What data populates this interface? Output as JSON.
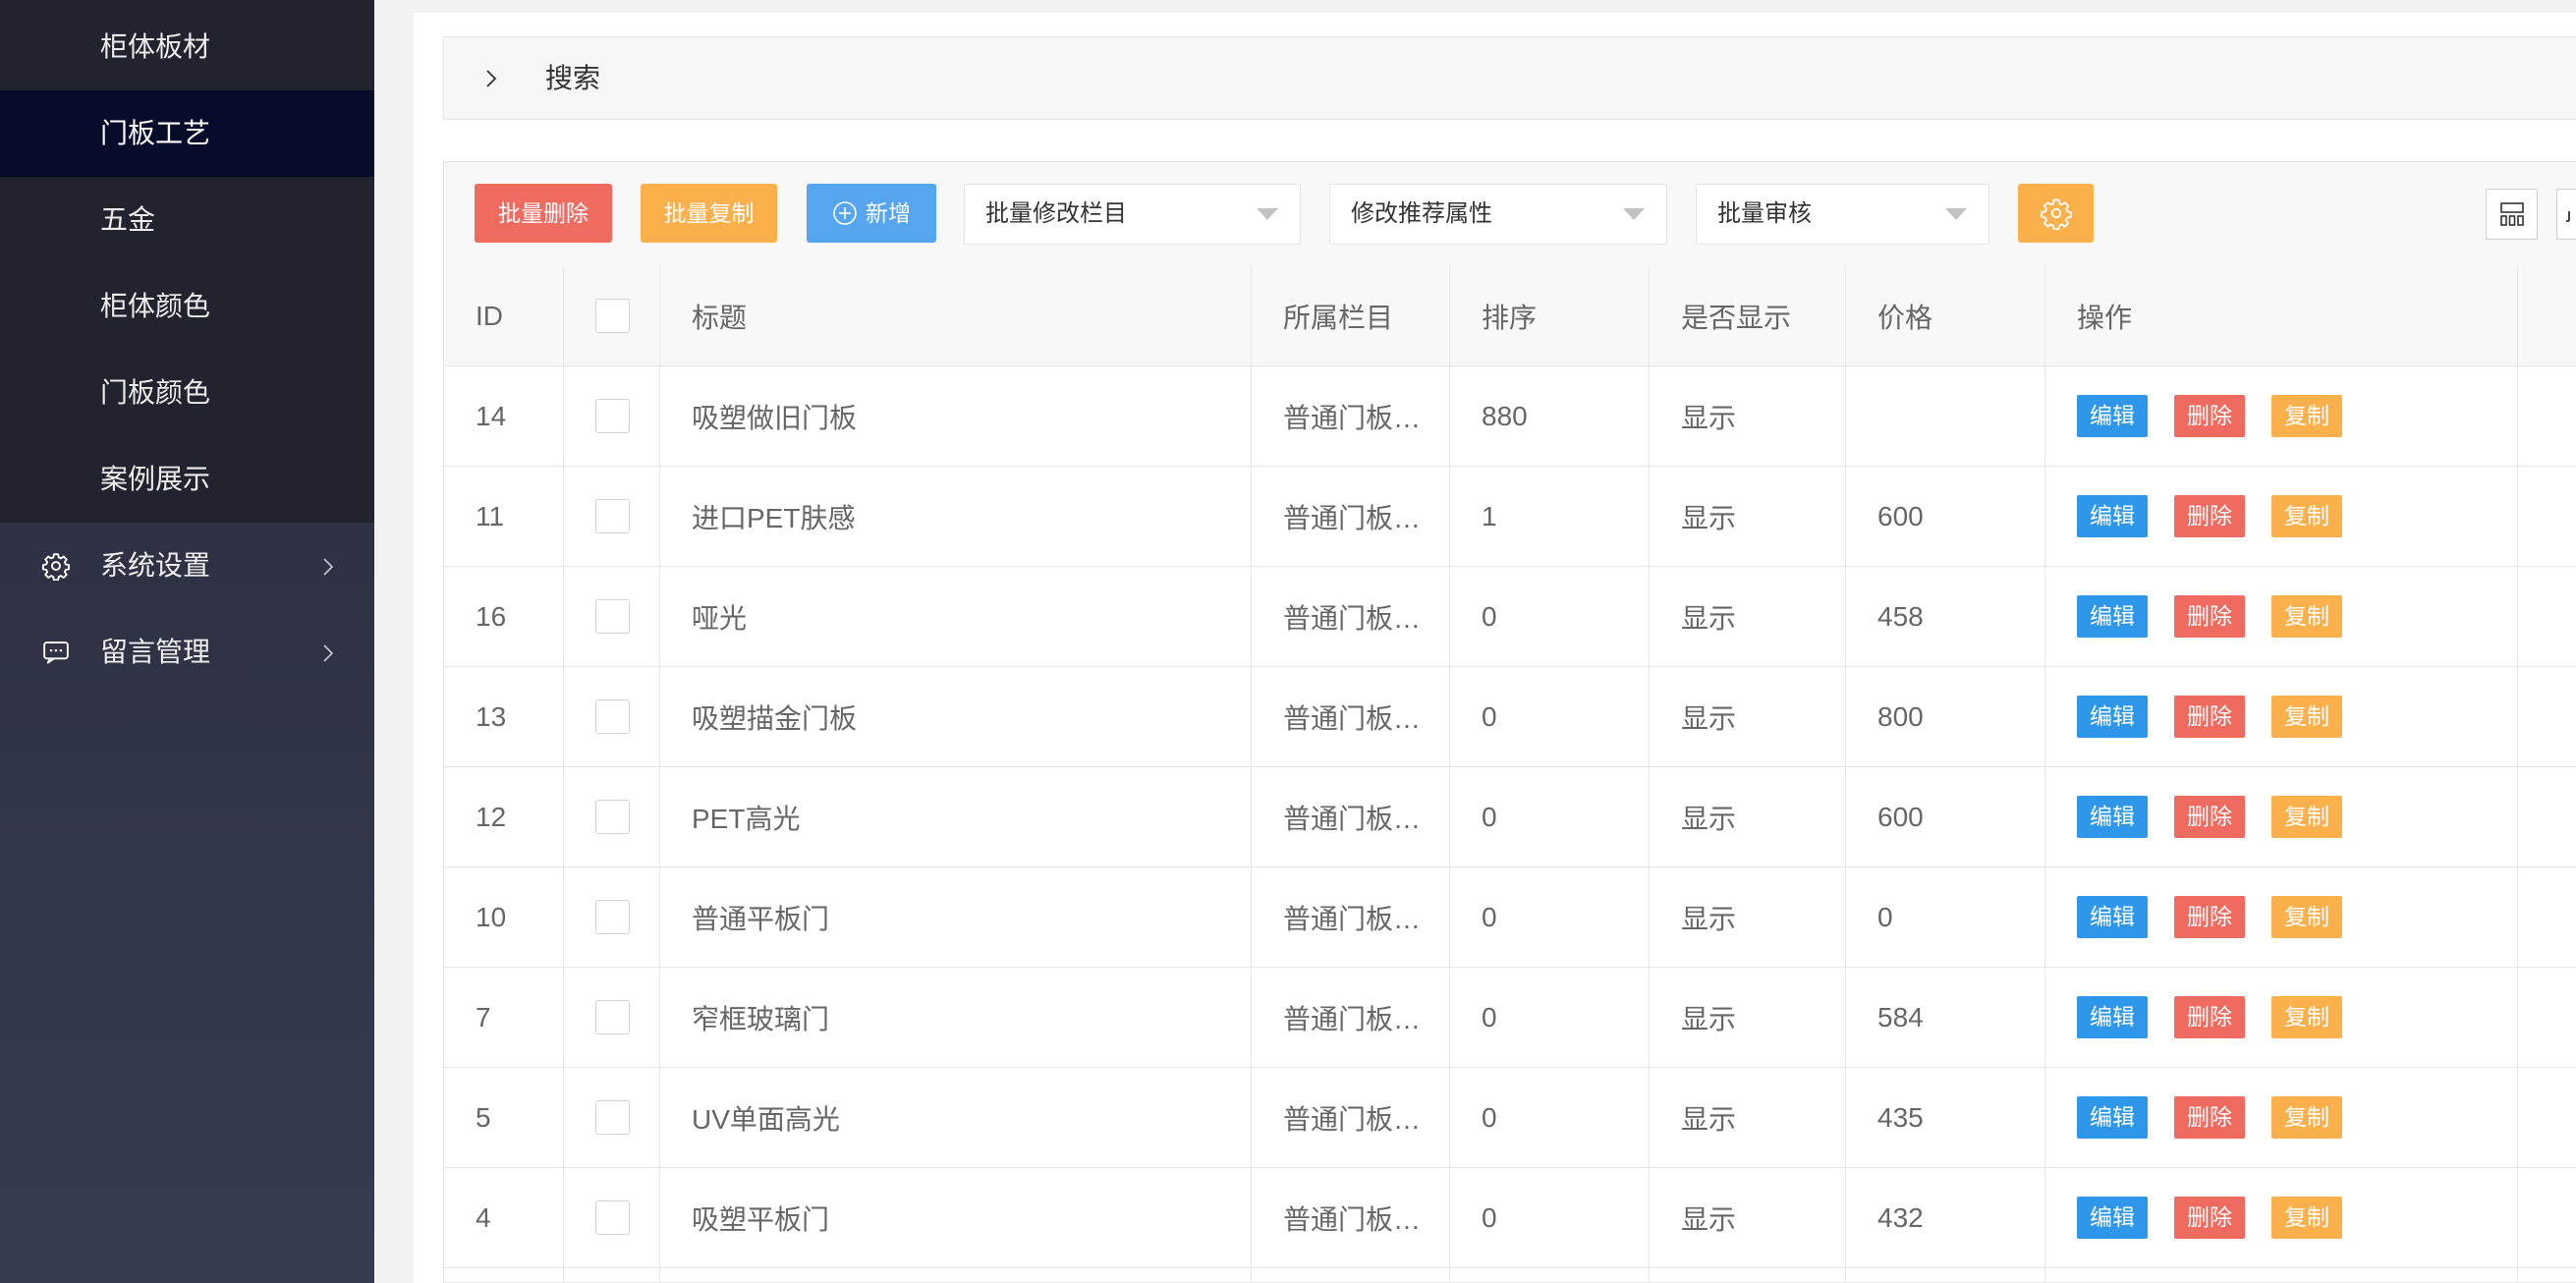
{
  "sidebar": {
    "submenu": [
      {
        "label": "柜体板材"
      },
      {
        "label": "门板工艺",
        "active": true
      },
      {
        "label": "五金"
      },
      {
        "label": "柜体颜色"
      },
      {
        "label": "门板颜色"
      },
      {
        "label": "案例展示"
      }
    ],
    "menu": [
      {
        "label": "系统设置",
        "icon": "gear-icon"
      },
      {
        "label": "留言管理",
        "icon": "message-icon"
      }
    ]
  },
  "search": {
    "label": "搜索",
    "icon": "chevron-right-icon"
  },
  "toolbar": {
    "batch_delete": "批量删除",
    "batch_copy": "批量复制",
    "add": "新增",
    "select_category": "批量修改栏目",
    "select_recommend": "修改推荐属性",
    "select_review": "批量审核",
    "settings_icon": "gear-icon",
    "layout_icon": "grid-icon",
    "export_icon": "export-icon"
  },
  "table": {
    "headers": {
      "id": "ID",
      "title": "标题",
      "category": "所属栏目",
      "sort": "排序",
      "visible": "是否显示",
      "price": "价格",
      "actions": "操作"
    },
    "rows": [
      {
        "id": "14",
        "title": "吸塑做旧门板",
        "category": "普通门板…",
        "sort": "880",
        "visible": "显示",
        "price": ""
      },
      {
        "id": "11",
        "title": "进口PET肤感",
        "category": "普通门板…",
        "sort": "1",
        "visible": "显示",
        "price": "600"
      },
      {
        "id": "16",
        "title": "哑光",
        "category": "普通门板…",
        "sort": "0",
        "visible": "显示",
        "price": "458"
      },
      {
        "id": "13",
        "title": "吸塑描金门板",
        "category": "普通门板…",
        "sort": "0",
        "visible": "显示",
        "price": "800"
      },
      {
        "id": "12",
        "title": "PET高光",
        "category": "普通门板…",
        "sort": "0",
        "visible": "显示",
        "price": "600"
      },
      {
        "id": "10",
        "title": "普通平板门",
        "category": "普通门板…",
        "sort": "0",
        "visible": "显示",
        "price": "0"
      },
      {
        "id": "7",
        "title": "窄框玻璃门",
        "category": "普通门板…",
        "sort": "0",
        "visible": "显示",
        "price": "584"
      },
      {
        "id": "5",
        "title": "UV单面高光",
        "category": "普通门板…",
        "sort": "0",
        "visible": "显示",
        "price": "435"
      },
      {
        "id": "4",
        "title": "吸塑平板门",
        "category": "普通门板…",
        "sort": "0",
        "visible": "显示",
        "price": "432"
      }
    ]
  },
  "row_actions": {
    "edit": "编辑",
    "delete": "删除",
    "copy": "复制"
  },
  "colors": {
    "sidebar_bg": "#2f3345",
    "submenu_bg": "#21242f",
    "active_item_bg": "#080c2b",
    "danger": "#ef6b5f",
    "warning": "#fbb04b",
    "primary": "#55a6ef",
    "edit": "#2e97ea"
  }
}
